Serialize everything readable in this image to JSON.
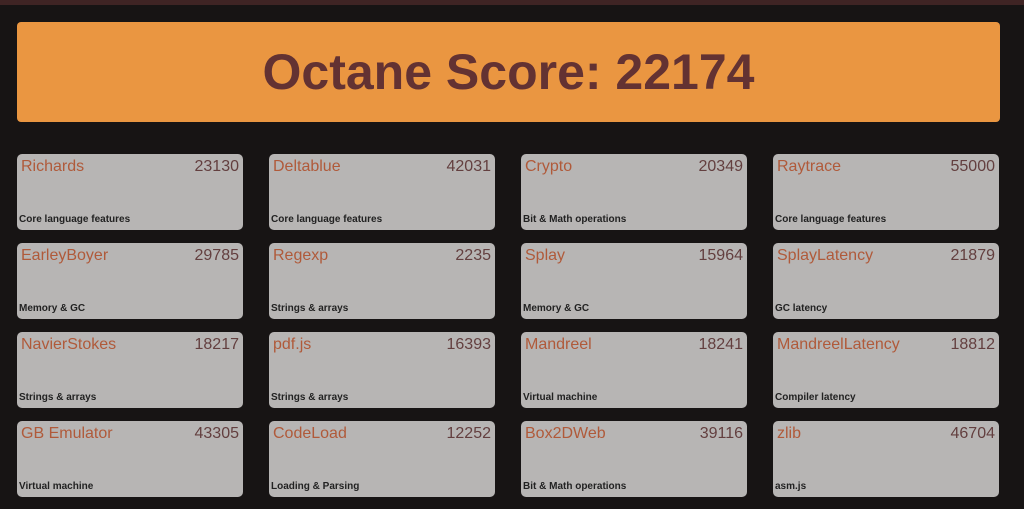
{
  "title": "Octane Score: 22174",
  "benchmarks": [
    {
      "name": "Richards",
      "score": "23130",
      "category": "Core language features"
    },
    {
      "name": "Deltablue",
      "score": "42031",
      "category": "Core language features"
    },
    {
      "name": "Crypto",
      "score": "20349",
      "category": "Bit & Math operations"
    },
    {
      "name": "Raytrace",
      "score": "55000",
      "category": "Core language features"
    },
    {
      "name": "EarleyBoyer",
      "score": "29785",
      "category": "Memory & GC"
    },
    {
      "name": "Regexp",
      "score": "2235",
      "category": "Strings & arrays"
    },
    {
      "name": "Splay",
      "score": "15964",
      "category": "Memory & GC"
    },
    {
      "name": "SplayLatency",
      "score": "21879",
      "category": "GC latency"
    },
    {
      "name": "NavierStokes",
      "score": "18217",
      "category": "Strings & arrays"
    },
    {
      "name": "pdf.js",
      "score": "16393",
      "category": "Strings & arrays"
    },
    {
      "name": "Mandreel",
      "score": "18241",
      "category": "Virtual machine"
    },
    {
      "name": "MandreelLatency",
      "score": "18812",
      "category": "Compiler latency"
    },
    {
      "name": "GB Emulator",
      "score": "43305",
      "category": "Virtual machine"
    },
    {
      "name": "CodeLoad",
      "score": "12252",
      "category": "Loading & Parsing"
    },
    {
      "name": "Box2DWeb",
      "score": "39116",
      "category": "Bit & Math operations"
    },
    {
      "name": "zlib",
      "score": "46704",
      "category": "asm.js"
    }
  ]
}
